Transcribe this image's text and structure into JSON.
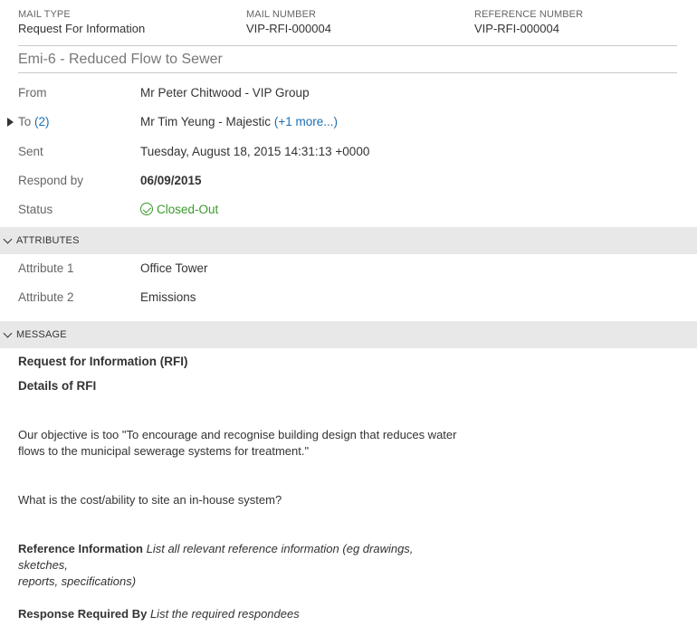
{
  "header": {
    "mail_type_label": "MAIL TYPE",
    "mail_type_value": "Request For Information",
    "mail_number_label": "MAIL NUMBER",
    "mail_number_value": "VIP-RFI-000004",
    "reference_number_label": "REFERENCE NUMBER",
    "reference_number_value": "VIP-RFI-000004"
  },
  "subject": "Emi-6 - Reduced Flow to Sewer",
  "fields": {
    "from_label": "From",
    "from_value": "Mr Peter Chitwood - VIP Group",
    "to_label": "To",
    "to_count": "(2)",
    "to_value": "Mr Tim Yeung - Majestic",
    "to_more": "(+1 more...)",
    "sent_label": "Sent",
    "sent_value": "Tuesday, August 18, 2015 14:31:13 +0000",
    "respond_by_label": "Respond by",
    "respond_by_value": "06/09/2015",
    "status_label": "Status",
    "status_value": "Closed-Out"
  },
  "attributes": {
    "title": "ATTRIBUTES",
    "attr1_label": "Attribute 1",
    "attr1_value": "Office Tower",
    "attr2_label": "Attribute 2",
    "attr2_value": "Emissions"
  },
  "message": {
    "title": "MESSAGE",
    "heading": "Request for Information (RFI)",
    "details_heading": "Details of RFI",
    "paragraph1_line1": "Our objective is too \"To encourage and recognise building design that reduces water",
    "paragraph1_line2": "flows to the municipal sewerage systems for treatment.\"",
    "paragraph2": "What is the cost/ability to site an in-house system?",
    "reference_label": "Reference Information",
    "reference_text_line1": "List all relevant reference information (eg drawings, sketches,",
    "reference_text_line2": "reports, specifications)",
    "response_label": "Response Required By",
    "response_text": "List the required respondees"
  },
  "colors": {
    "link": "#1a6fb5",
    "status_ok": "#3a9a2a",
    "section_bar": "#e8e8e8"
  }
}
